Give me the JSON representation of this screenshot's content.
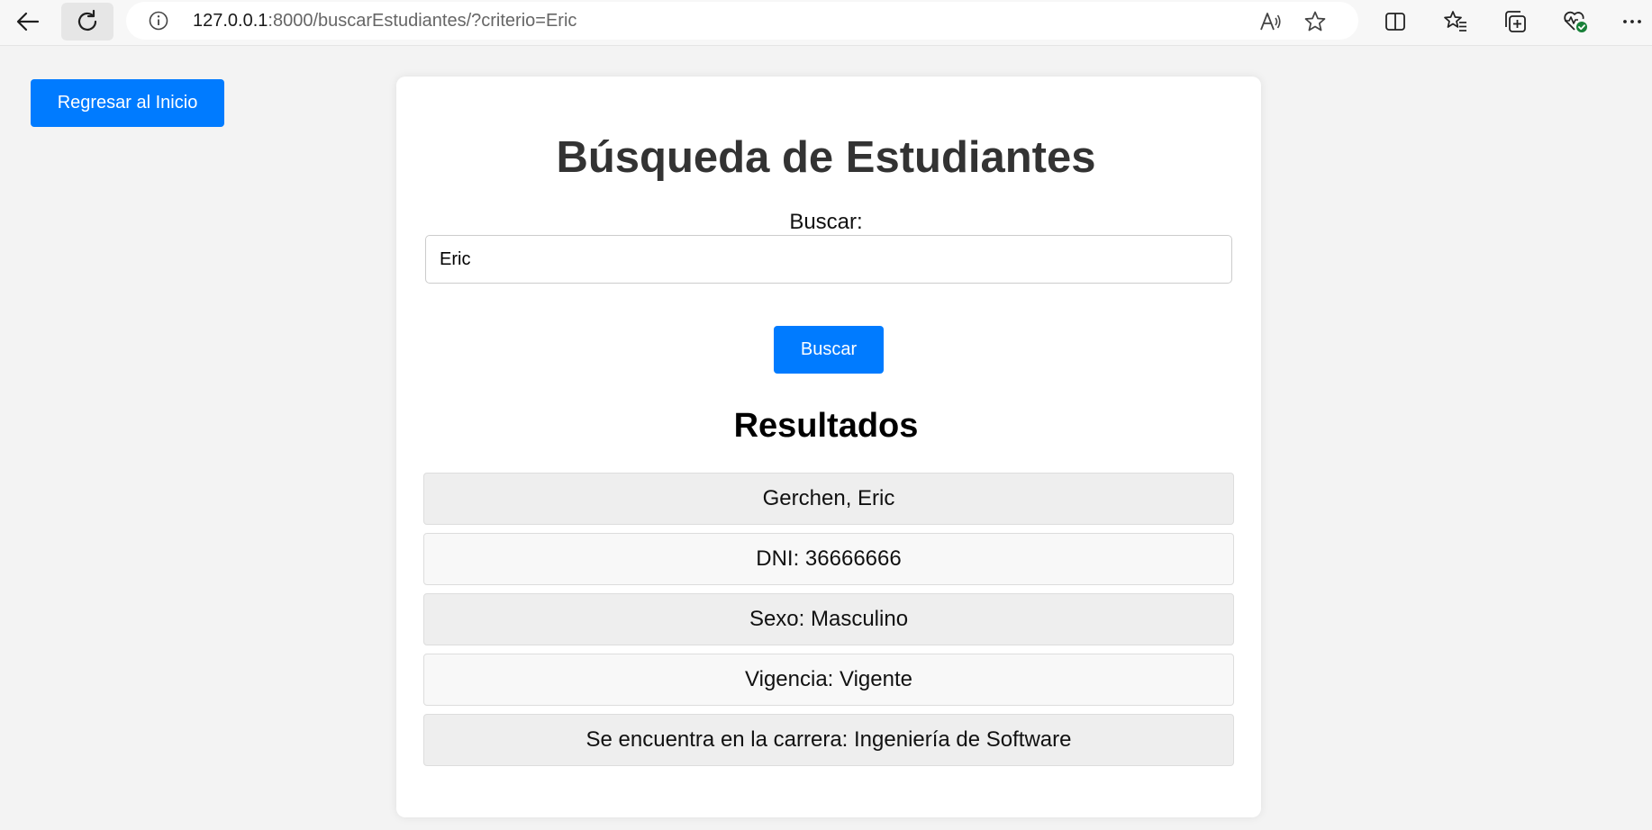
{
  "browser": {
    "url_host": "127.0.0.1",
    "url_rest": ":8000/buscarEstudiantes/?criterio=Eric",
    "icons": [
      "back-arrow-icon",
      "reload-icon",
      "info-icon",
      "read-aloud-icon",
      "favorite-star-icon",
      "split-screen-icon",
      "favorites-icon",
      "collections-icon",
      "browser-essentials-icon",
      "more-icon"
    ]
  },
  "home_button": {
    "label": "Regresar al Inicio"
  },
  "page": {
    "title": "Búsqueda de Estudiantes",
    "search_label": "Buscar:",
    "search_value": "Eric",
    "search_button": "Buscar",
    "results_title": "Resultados"
  },
  "results": [
    "Gerchen, Eric",
    "DNI: 36666666",
    "Sexo: Masculino",
    "Vigencia: Vigente",
    "Se encuentra en la carrera: Ingeniería de Software"
  ],
  "colors": {
    "primary": "#007bff",
    "background": "#f3f3f3",
    "card": "#ffffff",
    "row_odd": "#eeeeee",
    "row_even": "#f8f8f8"
  }
}
